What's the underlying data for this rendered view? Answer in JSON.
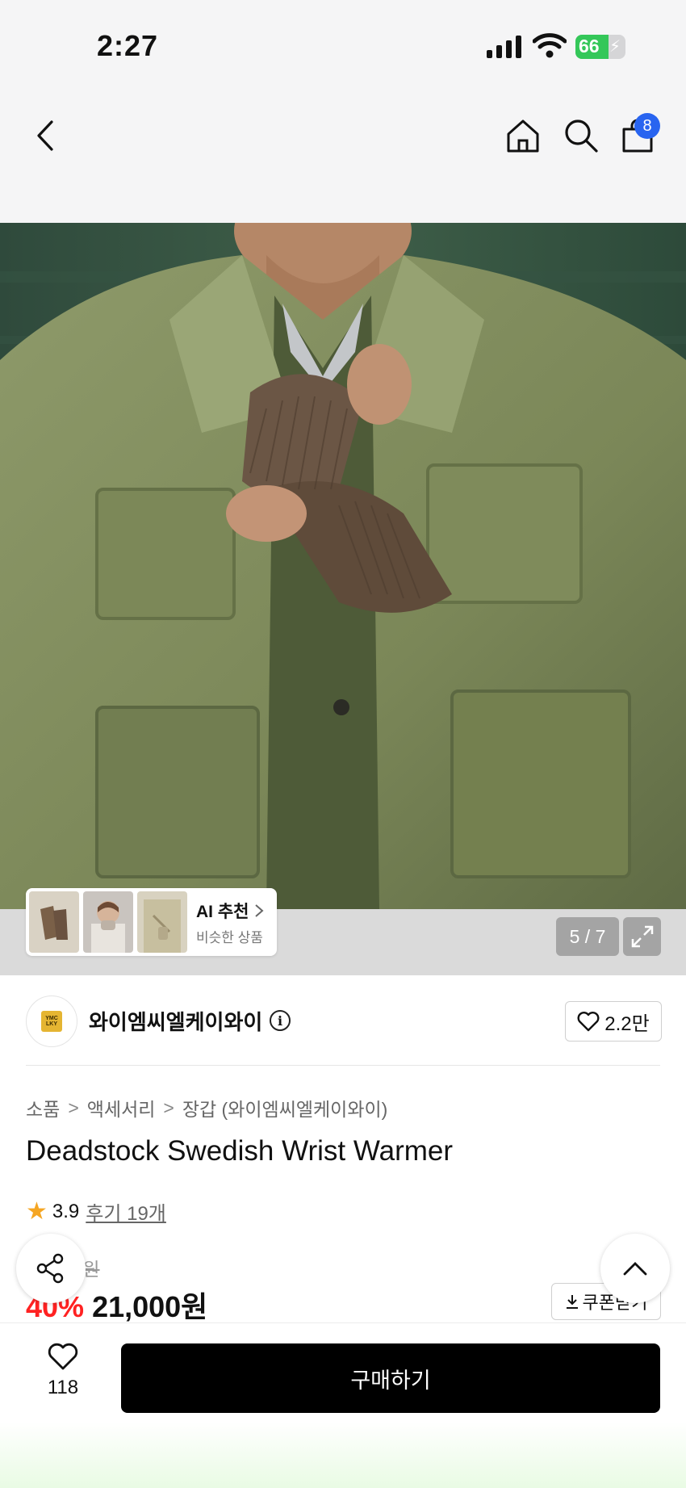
{
  "status_bar": {
    "time": "2:27",
    "battery_level": "66",
    "battery_fraction": 0.66
  },
  "nav": {
    "cart_count": "8"
  },
  "gallery": {
    "ai_recommend_label": "AI 추천",
    "ai_recommend_sub": "비슷한 상품",
    "counter": "5 / 7"
  },
  "store": {
    "name": "와이엠씨엘케이와이",
    "likes": "2.2만"
  },
  "breadcrumb": [
    "소품",
    "액세서리",
    "장갑 (와이엠씨엘케이와이)"
  ],
  "product": {
    "title": "Deadstock Swedish Wrist Warmer",
    "rating": "3.9",
    "review_label": "후기 19개",
    "original_price": "35,000원",
    "discount": "40%",
    "price": "21,000원"
  },
  "coupon_label": "쿠폰받기",
  "bottom": {
    "wish_count": "118",
    "buy_label": "구매하기"
  },
  "colors": {
    "accent_blue": "#2864f0",
    "discount_red": "#ff2222",
    "star": "#f5a623",
    "battery_green": "#34c759"
  },
  "icons": [
    "back-icon",
    "home-icon",
    "search-icon",
    "cart-icon",
    "expand-icon",
    "info-icon",
    "heart-icon",
    "share-icon",
    "chevron-up-icon",
    "download-icon",
    "star-icon",
    "chevron-right-icon"
  ]
}
